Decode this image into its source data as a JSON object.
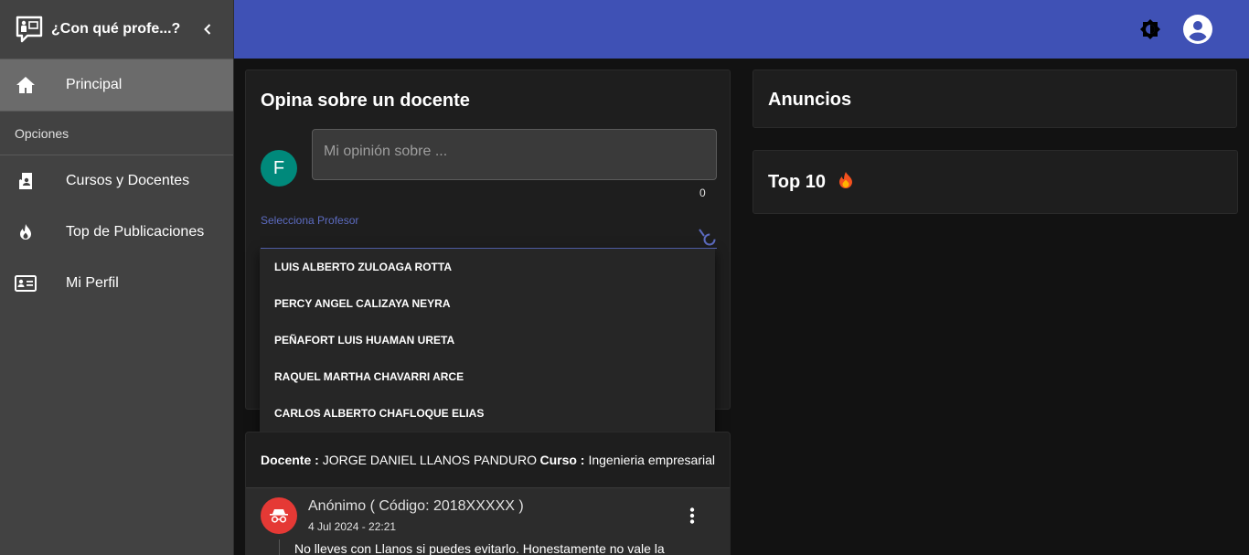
{
  "sidebar": {
    "title": "¿Con qué profe...?",
    "items": [
      {
        "label": "Principal",
        "icon": "home-icon"
      },
      {
        "label": "Cursos y Docentes",
        "icon": "book-icon"
      },
      {
        "label": "Top de Publicaciones",
        "icon": "fire-icon"
      },
      {
        "label": "Mi Perfil",
        "icon": "id-card-icon"
      }
    ],
    "section_label": "Opciones"
  },
  "topbar": {
    "theme_icon": "brightness-icon",
    "account_icon": "account-circle-icon",
    "color": "#3f51b5"
  },
  "opinion": {
    "title": "Opina sobre un docente",
    "avatar_letter": "F",
    "input_placeholder": "Mi opinión sobre ...",
    "counter": "0",
    "select_label": "Selecciona Profesor",
    "options": [
      "LUIS ALBERTO ZULOAGA ROTTA",
      "PERCY ANGEL CALIZAYA NEYRA",
      "PEÑAFORT LUIS HUAMAN URETA",
      "RAQUEL MARTHA CHAVARRI ARCE",
      "CARLOS ALBERTO CHAFLOQUE ELIAS"
    ]
  },
  "post": {
    "docente_label": "Docente :",
    "docente_value": "JORGE DANIEL LLANOS PANDURO",
    "curso_label": "Curso :",
    "curso_value": "Ingenieria empresarial",
    "author": "Anónimo ( Código: 2018XXXXX )",
    "date": "4 Jul 2024 - 22:21",
    "text": "No lleves con Llanos si puedes evitarlo. Honestamente no vale la"
  },
  "right": {
    "anuncios_title": "Anuncios",
    "top10_title": "Top 10"
  }
}
